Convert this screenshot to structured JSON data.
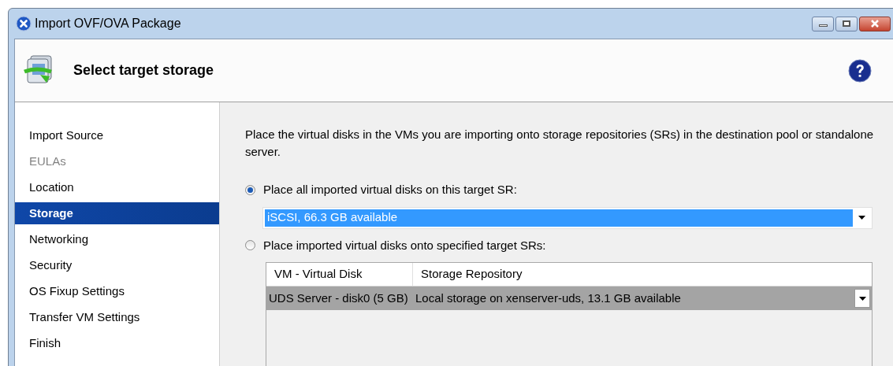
{
  "window": {
    "title": "Import OVF/OVA Package"
  },
  "header": {
    "title": "Select target storage"
  },
  "sidebar": {
    "items": [
      {
        "label": "Import Source",
        "selected": false,
        "disabled": false
      },
      {
        "label": "EULAs",
        "selected": false,
        "disabled": true
      },
      {
        "label": "Location",
        "selected": false,
        "disabled": false
      },
      {
        "label": "Storage",
        "selected": true,
        "disabled": false
      },
      {
        "label": "Networking",
        "selected": false,
        "disabled": false
      },
      {
        "label": "Security",
        "selected": false,
        "disabled": false
      },
      {
        "label": "OS Fixup Settings",
        "selected": false,
        "disabled": false
      },
      {
        "label": "Transfer VM Settings",
        "selected": false,
        "disabled": false
      },
      {
        "label": "Finish",
        "selected": false,
        "disabled": false
      }
    ]
  },
  "content": {
    "description": "Place the virtual disks in the VMs you are importing onto storage repositories (SRs) in the destination pool or standalone server.",
    "options": [
      {
        "label": "Place all imported virtual disks on this target SR:",
        "selected": true,
        "dropdown": {
          "value": "iSCSI, 66.3 GB available"
        }
      },
      {
        "label": "Place imported virtual disks onto specified target SRs:",
        "selected": false,
        "table": {
          "columns": [
            "VM - Virtual Disk",
            "Storage Repository"
          ],
          "rows": [
            {
              "cells": [
                "UDS Server - disk0 (5 GB)",
                "Local storage on xenserver-uds, 13.1 GB available"
              ],
              "selected": true
            }
          ]
        }
      }
    ]
  }
}
